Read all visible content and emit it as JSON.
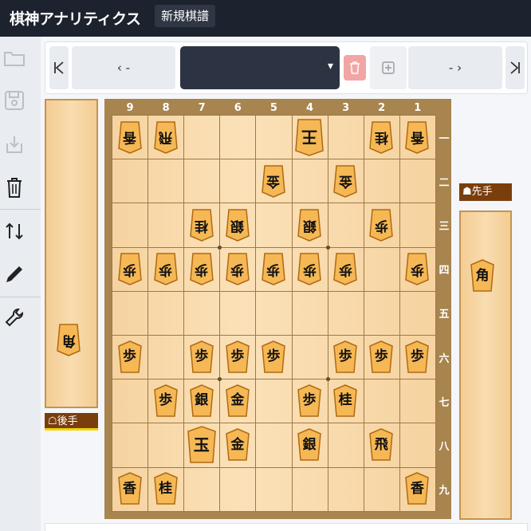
{
  "header": {
    "app_title": "棋神アナリティクス",
    "new_game_label": "新規棋譜"
  },
  "sidebar": {
    "icons": [
      "folder-open-icon",
      "save-icon",
      "download-icon",
      "trash-icon",
      "swap-vertical-icon",
      "pen-icon",
      "wrench-icon"
    ]
  },
  "toolbar": {
    "prev_label": "‹ -",
    "next_label": "- ›",
    "first_icon": "first-move-icon",
    "last_icon": "last-move-icon",
    "caret": "▾",
    "add_icon": "plus-square-icon",
    "delete_icon": "trash-icon"
  },
  "players": {
    "gote_label": "☖後手",
    "sente_label": "☗先手"
  },
  "board": {
    "files": [
      "9",
      "8",
      "7",
      "6",
      "5",
      "4",
      "3",
      "2",
      "1"
    ],
    "ranks": [
      "一",
      "二",
      "三",
      "四",
      "五",
      "六",
      "七",
      "八",
      "九"
    ],
    "pieces": [
      {
        "file": 9,
        "rank": 1,
        "glyph": "香",
        "side": "gote"
      },
      {
        "file": 8,
        "rank": 1,
        "glyph": "飛",
        "side": "gote"
      },
      {
        "file": 4,
        "rank": 1,
        "glyph": "王",
        "side": "gote"
      },
      {
        "file": 2,
        "rank": 1,
        "glyph": "桂",
        "side": "gote"
      },
      {
        "file": 1,
        "rank": 1,
        "glyph": "香",
        "side": "gote"
      },
      {
        "file": 5,
        "rank": 2,
        "glyph": "金",
        "side": "gote"
      },
      {
        "file": 3,
        "rank": 2,
        "glyph": "金",
        "side": "gote"
      },
      {
        "file": 7,
        "rank": 3,
        "glyph": "桂",
        "side": "gote"
      },
      {
        "file": 6,
        "rank": 3,
        "glyph": "銀",
        "side": "gote"
      },
      {
        "file": 4,
        "rank": 3,
        "glyph": "銀",
        "side": "gote"
      },
      {
        "file": 2,
        "rank": 3,
        "glyph": "歩",
        "side": "gote"
      },
      {
        "file": 9,
        "rank": 4,
        "glyph": "歩",
        "side": "gote"
      },
      {
        "file": 8,
        "rank": 4,
        "glyph": "歩",
        "side": "gote"
      },
      {
        "file": 7,
        "rank": 4,
        "glyph": "歩",
        "side": "gote"
      },
      {
        "file": 6,
        "rank": 4,
        "glyph": "歩",
        "side": "gote"
      },
      {
        "file": 5,
        "rank": 4,
        "glyph": "歩",
        "side": "gote"
      },
      {
        "file": 4,
        "rank": 4,
        "glyph": "歩",
        "side": "gote"
      },
      {
        "file": 3,
        "rank": 4,
        "glyph": "歩",
        "side": "gote"
      },
      {
        "file": 1,
        "rank": 4,
        "glyph": "歩",
        "side": "gote"
      },
      {
        "file": 9,
        "rank": 6,
        "glyph": "歩",
        "side": "sente"
      },
      {
        "file": 7,
        "rank": 6,
        "glyph": "歩",
        "side": "sente"
      },
      {
        "file": 6,
        "rank": 6,
        "glyph": "歩",
        "side": "sente"
      },
      {
        "file": 5,
        "rank": 6,
        "glyph": "歩",
        "side": "sente"
      },
      {
        "file": 3,
        "rank": 6,
        "glyph": "歩",
        "side": "sente"
      },
      {
        "file": 2,
        "rank": 6,
        "glyph": "歩",
        "side": "sente"
      },
      {
        "file": 1,
        "rank": 6,
        "glyph": "歩",
        "side": "sente"
      },
      {
        "file": 8,
        "rank": 7,
        "glyph": "歩",
        "side": "sente"
      },
      {
        "file": 7,
        "rank": 7,
        "glyph": "銀",
        "side": "sente"
      },
      {
        "file": 6,
        "rank": 7,
        "glyph": "金",
        "side": "sente"
      },
      {
        "file": 4,
        "rank": 7,
        "glyph": "歩",
        "side": "sente"
      },
      {
        "file": 3,
        "rank": 7,
        "glyph": "桂",
        "side": "sente"
      },
      {
        "file": 7,
        "rank": 8,
        "glyph": "玉",
        "side": "sente"
      },
      {
        "file": 6,
        "rank": 8,
        "glyph": "金",
        "side": "sente"
      },
      {
        "file": 4,
        "rank": 8,
        "glyph": "銀",
        "side": "sente"
      },
      {
        "file": 2,
        "rank": 8,
        "glyph": "飛",
        "side": "sente"
      },
      {
        "file": 9,
        "rank": 9,
        "glyph": "香",
        "side": "sente"
      },
      {
        "file": 8,
        "rank": 9,
        "glyph": "桂",
        "side": "sente"
      },
      {
        "file": 1,
        "rank": 9,
        "glyph": "香",
        "side": "sente"
      }
    ]
  },
  "hands": {
    "gote": [
      {
        "glyph": "角",
        "count": 1
      }
    ],
    "sente": [
      {
        "glyph": "角",
        "count": 1
      }
    ]
  },
  "colors": {
    "piece_fill": "#f5b855",
    "piece_edge": "#b06a12",
    "highlight": "#f3d400"
  }
}
